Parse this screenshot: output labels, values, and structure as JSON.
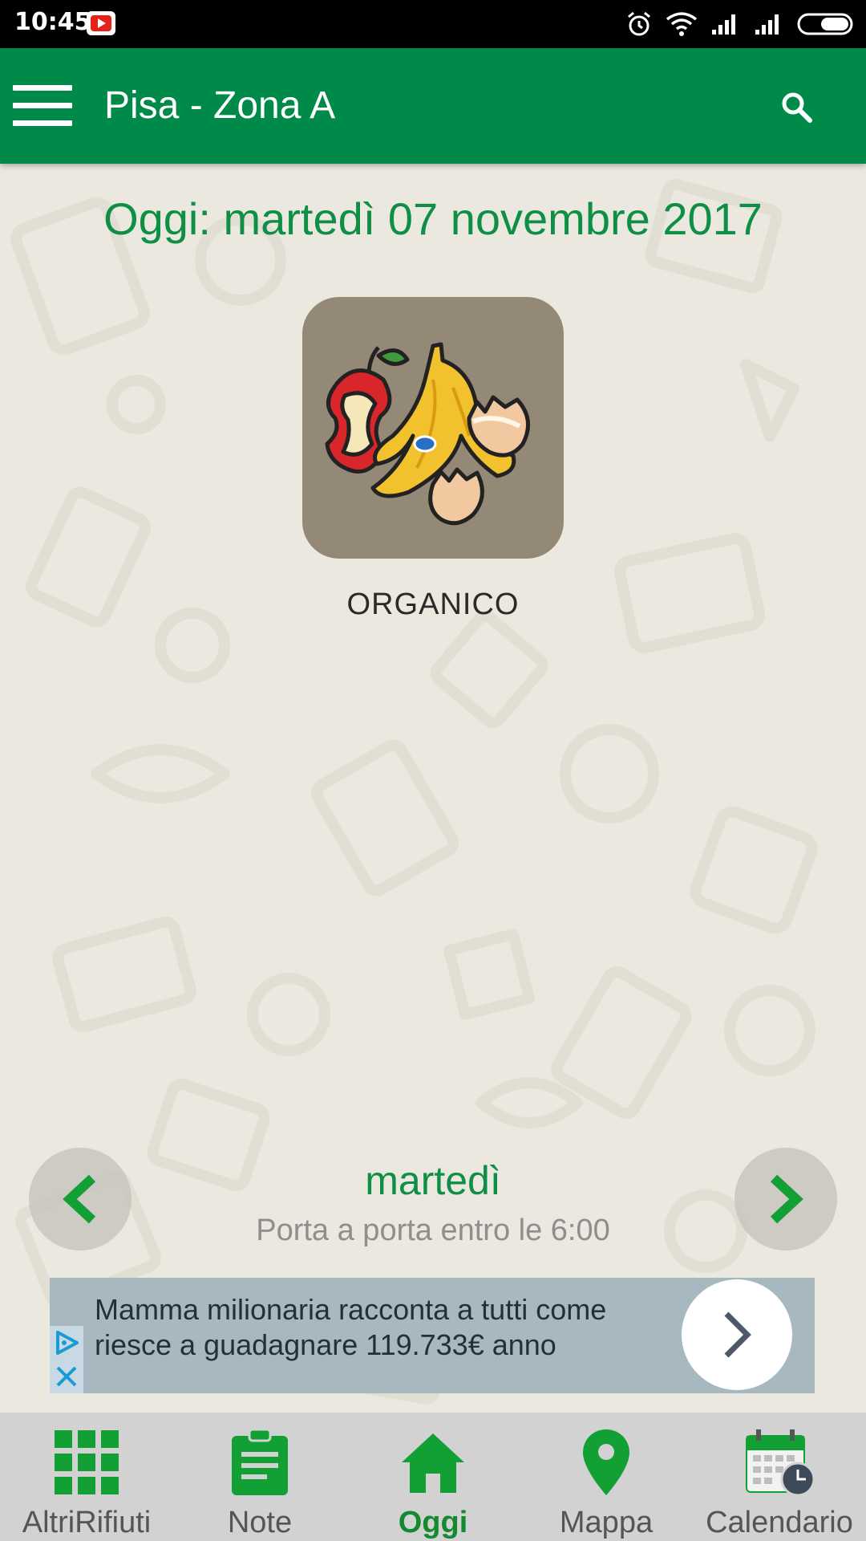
{
  "status_bar": {
    "time": "10:45"
  },
  "app_bar": {
    "title": "Pisa - Zona A"
  },
  "today": {
    "label": "Oggi: martedì 07 novembre 2017",
    "waste_type": "ORGANICO",
    "day_name": "martedì",
    "collection_note": "Porta a porta entro le 6:00"
  },
  "ad": {
    "text_line1": "Mamma milionaria racconta a tutti come",
    "text_line2": "riesce a guadagnare 119.733€ anno"
  },
  "bottom_nav": {
    "items": [
      {
        "label": "AltriRifiuti",
        "icon": "grid-icon",
        "active": false
      },
      {
        "label": "Note",
        "icon": "clipboard-icon",
        "active": false
      },
      {
        "label": "Oggi",
        "icon": "home-icon",
        "active": true
      },
      {
        "label": "Mappa",
        "icon": "map-pin-icon",
        "active": false
      },
      {
        "label": "Calendario",
        "icon": "calendar-icon",
        "active": false
      }
    ]
  },
  "colors": {
    "primary": "#008a4a",
    "accent_green": "#0f8f46",
    "nav_icon_green": "#12a035",
    "card_bg": "#948877"
  }
}
